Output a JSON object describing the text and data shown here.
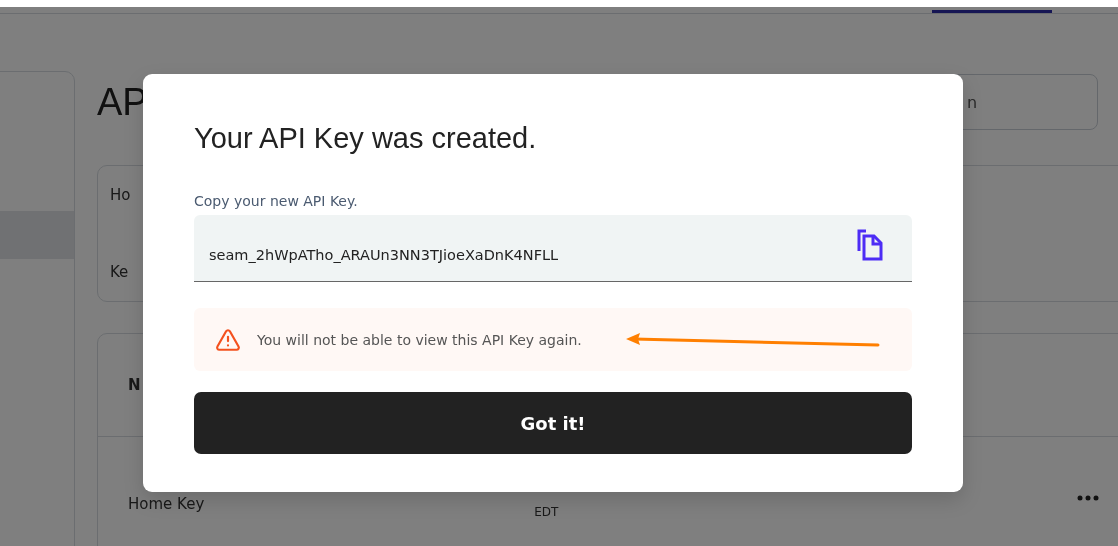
{
  "nav": {
    "tabs": [
      {
        "selected": true
      }
    ]
  },
  "sidebar": {
    "items": [
      {
        "selected": true
      }
    ]
  },
  "page": {
    "heading": "AP",
    "search": {
      "placeholder": "n"
    },
    "details": [
      {
        "label": "Ho"
      },
      {
        "label": "Ke"
      }
    ],
    "table": {
      "columns": [
        "N"
      ],
      "rows": [
        {
          "name": "Home Key",
          "created": "EDT"
        }
      ]
    }
  },
  "dialog": {
    "title": "Your API Key was created.",
    "field_label": "Copy your new API Key.",
    "api_key": "seam_2hWpATho_ARAUn3NN3TJioeXaDnK4NFLL",
    "warning": "You will not be able to view this API Key again.",
    "button": "Got it!"
  }
}
